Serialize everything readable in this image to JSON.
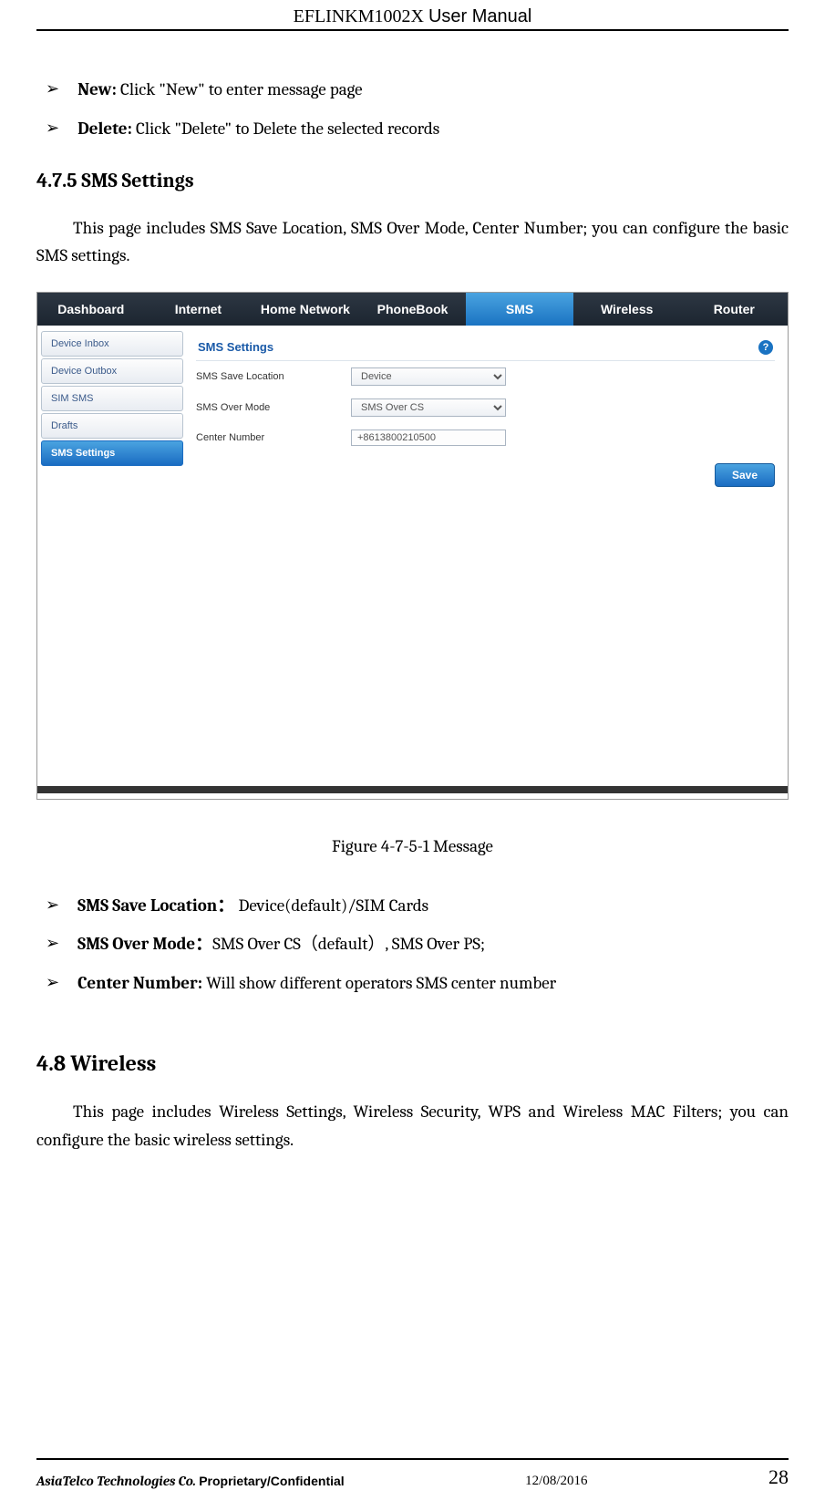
{
  "header": {
    "title_prefix": "EFLINKM1002X ",
    "title_suffix": "User Manual"
  },
  "bullets_top": [
    {
      "label": "New:",
      "text": " Click \"New\" to enter message page"
    },
    {
      "label": "Delete:",
      "text": " Click \"Delete\" to Delete the selected records"
    }
  ],
  "section475": {
    "heading": "4.7.5 SMS Settings",
    "paragraph": "This page includes SMS Save Location, SMS Over Mode, Center Number; you can configure the basic SMS settings."
  },
  "screenshot": {
    "nav": [
      "Dashboard",
      "Internet",
      "Home Network",
      "PhoneBook",
      "SMS",
      "Wireless",
      "Router"
    ],
    "nav_active_index": 4,
    "sidebar": [
      "Device Inbox",
      "Device Outbox",
      "SIM SMS",
      "Drafts",
      "SMS Settings"
    ],
    "sidebar_active_index": 4,
    "panel_title": "SMS Settings",
    "help_glyph": "?",
    "fields": {
      "save_location": {
        "label": "SMS Save Location",
        "value": "Device"
      },
      "over_mode": {
        "label": "SMS Over Mode",
        "value": "SMS Over CS"
      },
      "center_number": {
        "label": "Center Number",
        "value": "+8613800210500"
      }
    },
    "save_button": "Save"
  },
  "figure_caption": "Figure 4-7-5-1 Message",
  "bullets_bottom": [
    {
      "label": "SMS Save Location：",
      "text": " Device(default)/SIM Cards"
    },
    {
      "label": "SMS Over Mode：",
      "text": "SMS Over CS（default）, SMS Over PS;"
    },
    {
      "label": "Center Number:",
      "text": " Will show different operators SMS center number"
    }
  ],
  "section48": {
    "heading": "4.8 Wireless",
    "paragraph": "This page includes Wireless Settings, Wireless Security, WPS and Wireless MAC Filters; you can configure the basic wireless settings."
  },
  "footer": {
    "company": "AsiaTelco Technologies Co. ",
    "confidential": "Proprietary/Confidential",
    "date": "12/08/2016",
    "page": "28"
  }
}
